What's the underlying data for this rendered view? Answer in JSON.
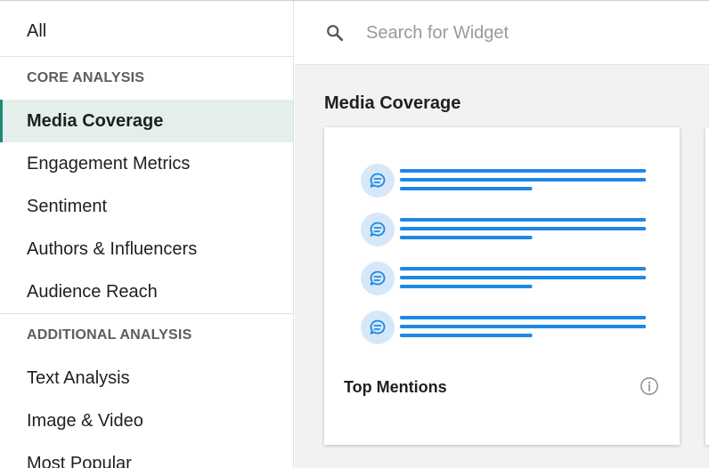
{
  "sidebar": {
    "all_label": "All",
    "sections": [
      {
        "header": "CORE ANALYSIS",
        "items": [
          {
            "label": "Media Coverage",
            "active": true
          },
          {
            "label": "Engagement Metrics"
          },
          {
            "label": "Sentiment"
          },
          {
            "label": "Authors & Influencers"
          },
          {
            "label": "Audience Reach"
          }
        ]
      },
      {
        "header": "ADDITIONAL ANALYSIS",
        "items": [
          {
            "label": "Text Analysis"
          },
          {
            "label": "Image & Video"
          },
          {
            "label": "Most Popular"
          }
        ]
      }
    ]
  },
  "search": {
    "icon": "search-icon",
    "placeholder": "Search for Widget",
    "value": ""
  },
  "main": {
    "section_title": "Media Coverage",
    "widgets": [
      {
        "name": "Top Mentions",
        "preview_icon": "chat-bubble-icon",
        "info_icon": "info-icon"
      }
    ]
  },
  "colors": {
    "accent": "#1f8a74",
    "active_bg": "#e4efec",
    "preview_line": "#1e88e5",
    "preview_icon_bg": "#d6e8f8"
  }
}
